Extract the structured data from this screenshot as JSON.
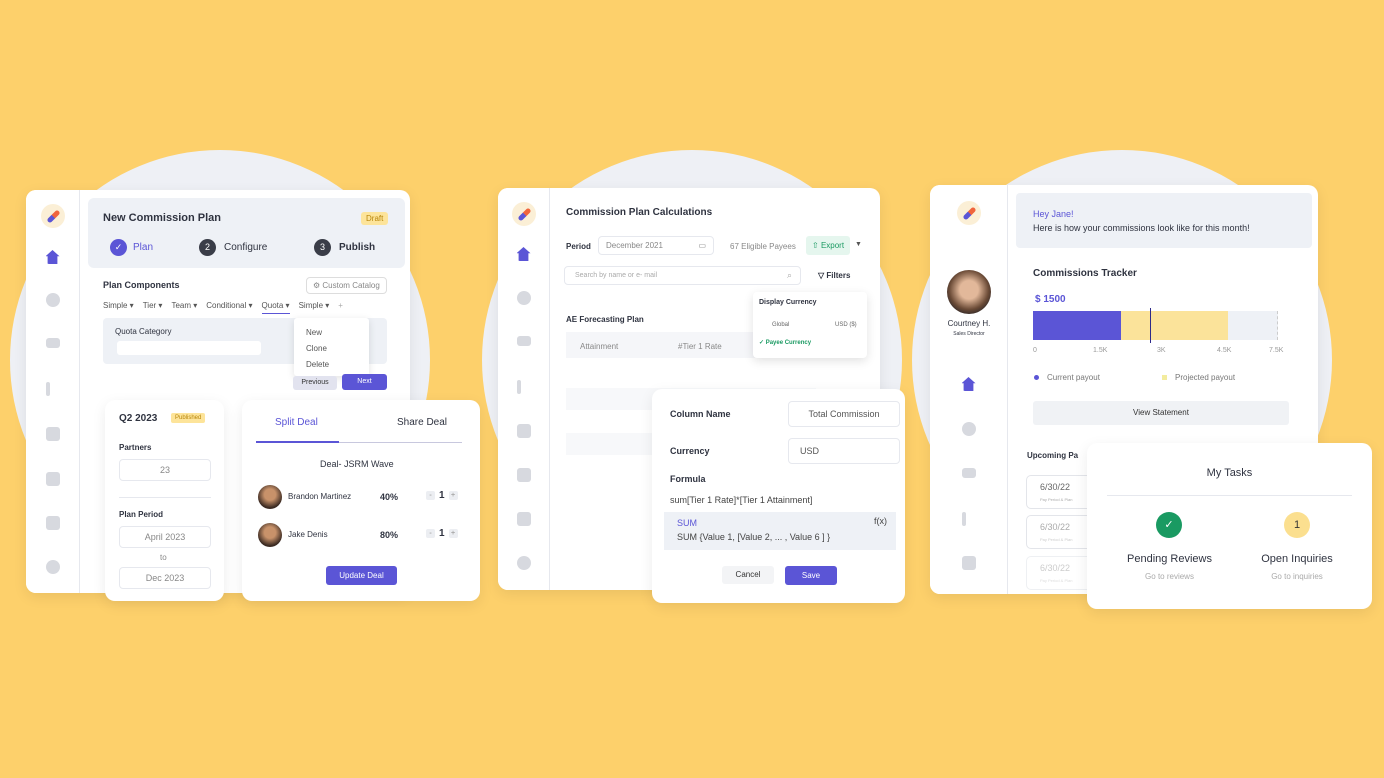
{
  "colors": {
    "background": "#FDD06B",
    "accent": "#5b55d6",
    "success": "#1a9a62",
    "projected": "#fbe39a"
  },
  "plan": {
    "title": "New Commission Plan",
    "badge": "Draft",
    "steps": [
      {
        "num": "✓",
        "label": "Plan"
      },
      {
        "num": "2",
        "label": "Configure"
      },
      {
        "num": "3",
        "label": "Publish"
      }
    ],
    "components_title": "Plan Components",
    "custom_catalog": "Custom Catalog",
    "tabs": [
      "Simple",
      "Tier",
      "Team",
      "Conditional",
      "Quota",
      "Simple"
    ],
    "add": "+",
    "quota_category": "Quota Category",
    "menu": [
      "New",
      "Clone",
      "Delete"
    ],
    "previous": "Previous",
    "next": "Next"
  },
  "quarter": {
    "title": "Q2 2023",
    "badge": "Published",
    "partners_label": "Partners",
    "partners": "23",
    "period_label": "Plan Period",
    "from": "April 2023",
    "to_label": "to",
    "to": "Dec 2023"
  },
  "deal": {
    "tabs": [
      "Split Deal",
      "Share Deal"
    ],
    "title": "Deal- JSRM Wave",
    "people": [
      {
        "name": "Brandon Martinez",
        "pct": "40%",
        "qty": "1"
      },
      {
        "name": "Jake Denis",
        "pct": "80%",
        "qty": "1"
      }
    ],
    "minus": "-",
    "plus": "+",
    "update": "Update Deal"
  },
  "calc": {
    "title": "Commission Plan Calculations",
    "period_label": "Period",
    "period": "December 2021",
    "payees": "67 Eligible Payees",
    "export": "Export",
    "search_placeholder": "Search by name or e- mail",
    "filters": "Filters",
    "plan": "AE Forecasting Plan",
    "columns": [
      "Attainment",
      "#Tier 1 Rate"
    ],
    "currency_menu": {
      "title": "Display Currency",
      "global": "Global",
      "global_value": "USD ($)",
      "payee": "Payee Currency"
    }
  },
  "formula": {
    "column_label": "Column Name",
    "column_value": "Total Commission",
    "currency_label": "Currency",
    "currency_value": "USD",
    "formula_label": "Formula",
    "expression": "sum[Tier 1 Rate]*[Tier 1 Attainment]",
    "fn_name": "SUM",
    "fn_sig": "SUM {Value 1, [Value 2, ... , Value 6 ] }",
    "fx": "f(x)",
    "cancel": "Cancel",
    "save": "Save"
  },
  "dashboard": {
    "user": "Courtney H.",
    "role": "Sales Director",
    "greeting": "Hey Jane!",
    "subtitle": "Here is how your commissions look like for this month!",
    "tracker_title": "Commissions Tracker",
    "amount": "$ 1500",
    "ticks": [
      "0",
      "1.5K",
      "3K",
      "4.5K",
      "7.5K"
    ],
    "current_payout": 3000,
    "projected_payout": 4500,
    "max": 7500,
    "legend": [
      "Current payout",
      "Projected payout"
    ],
    "view_statement": "View Statement",
    "upcoming": "Upcoming Pa",
    "payouts": [
      {
        "date": "6/30/22",
        "sub": "Pay Period & Plan"
      },
      {
        "date": "6/30/22",
        "sub": "Pay Period & Plan"
      },
      {
        "date": "6/30/22",
        "sub": "Pay Period & Plan"
      }
    ]
  },
  "tasks": {
    "title": "My Tasks",
    "items": [
      {
        "label": "Pending Reviews",
        "link": "Go to reviews",
        "badge": "✓"
      },
      {
        "label": "Open Inquiries",
        "link": "Go to inquiries",
        "badge": "1"
      }
    ]
  }
}
